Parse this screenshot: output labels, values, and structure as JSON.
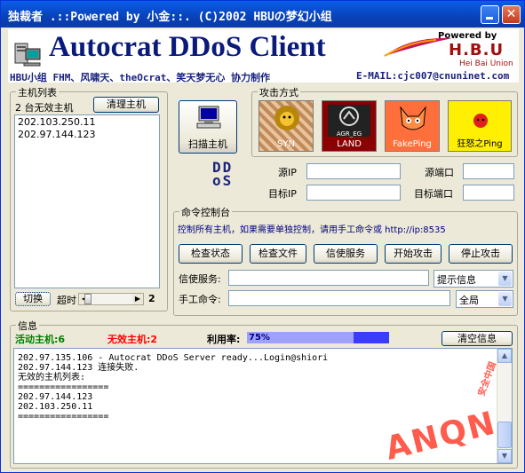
{
  "window": {
    "title": "独裁者 .::Powered by 小金::. (C)2002 HBUの梦幻小组"
  },
  "header": {
    "app_title": "Autocrat DDoS Client",
    "subtitle": "HBU小组 FHM、风啸天、theOcrat、笑天梦无心 协力制作",
    "email": "E-MAIL:cjc007@cnuninet.com",
    "powered_by": "Powered by",
    "brand": "H.B.U",
    "brand_sub": "Hei Bai Union"
  },
  "host_list": {
    "legend": "主机列表",
    "invalid_count_label": "2 台无效主机",
    "clean_button": "清理主机",
    "hosts": [
      "202.103.250.11",
      "202.97.144.123"
    ],
    "switch_button": "切换",
    "timeout_label": "超时",
    "timeout_value": "2"
  },
  "scan_button": "扫描主机",
  "ddos_logo": "DDoS",
  "attack": {
    "legend": "攻击方式",
    "methods": [
      {
        "label": "SYN",
        "color": "#a0522d"
      },
      {
        "label": "LAND",
        "color": "#8b0000"
      },
      {
        "label": "FakePing",
        "color": "#ff6f3c"
      },
      {
        "label": "狂怒之Ping",
        "color": "#ffef00"
      }
    ],
    "land_inner": "AGR_EG"
  },
  "ports": {
    "src_ip_label": "源IP",
    "dst_ip_label": "目标IP",
    "src_port_label": "源端口",
    "dst_port_label": "目标端口",
    "src_ip": "",
    "dst_ip": "",
    "src_port": "",
    "dst_port": ""
  },
  "command": {
    "legend": "命令控制台",
    "hint": "控制所有主机，如果需要单独控制，请用手工命令或 http://ip:8535",
    "buttons": [
      "检查状态",
      "检查文件",
      "信使服务",
      "开始攻击",
      "停止攻击"
    ],
    "messenger_label": "信使服务:",
    "messenger_value": "",
    "messenger_select": "提示信息",
    "manual_label": "手工命令:",
    "manual_value": "",
    "manual_select": "全局"
  },
  "info": {
    "legend": "信息",
    "active_label": "活动主机:6",
    "invalid_label": "无效主机:2",
    "usage_label": "利用率:",
    "usage_percent": "75%",
    "usage_fraction": 0.75,
    "clear_button": "清空信息",
    "log_lines": [
      "202.97.135.106 - Autocrat DDoS Server ready...Login@shiori",
      "",
      "202.97.144.123 连接失败.",
      "无效的主机列表:",
      "=================",
      "202.97.144.123",
      "202.103.250.11",
      "",
      "================="
    ]
  },
  "watermark": {
    "text": "ANQN",
    "sub": "安全中国"
  },
  "colors": {
    "active": "#008000",
    "invalid": "#ff0000",
    "title_blue": "#0a1a7a",
    "progress": "#3c3cff"
  }
}
